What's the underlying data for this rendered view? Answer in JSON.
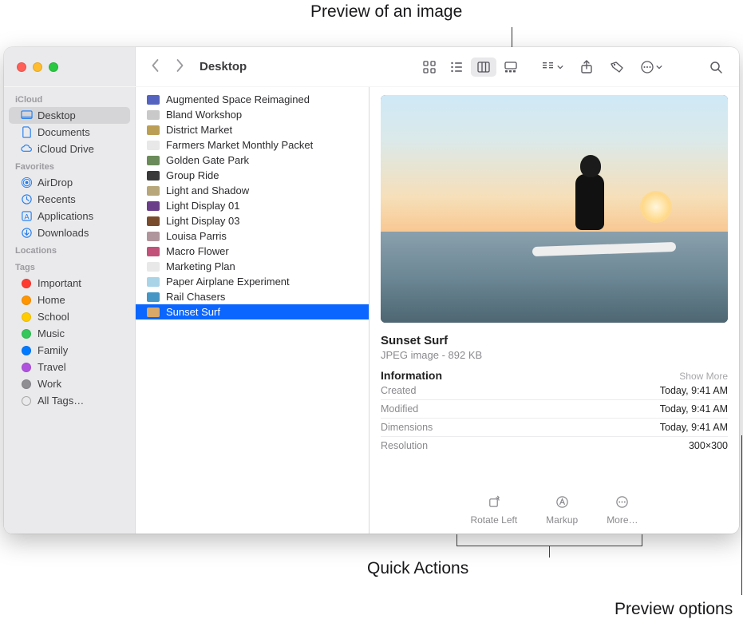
{
  "callouts": {
    "preview_image": "Preview of an image",
    "quick_actions": "Quick Actions",
    "preview_options": "Preview options"
  },
  "window": {
    "title": "Desktop"
  },
  "sidebar": {
    "sections": {
      "icloud": "iCloud",
      "favorites": "Favorites",
      "locations": "Locations",
      "tags": "Tags"
    },
    "icloud_items": [
      {
        "label": "Desktop",
        "icon": "desktop"
      },
      {
        "label": "Documents",
        "icon": "doc"
      },
      {
        "label": "iCloud Drive",
        "icon": "cloud"
      }
    ],
    "favorites_items": [
      {
        "label": "AirDrop",
        "icon": "airdrop"
      },
      {
        "label": "Recents",
        "icon": "clock"
      },
      {
        "label": "Applications",
        "icon": "apps"
      },
      {
        "label": "Downloads",
        "icon": "download"
      }
    ],
    "tags_items": [
      {
        "label": "Important",
        "color": "#ff3b30"
      },
      {
        "label": "Home",
        "color": "#ff9500"
      },
      {
        "label": "School",
        "color": "#ffcc00"
      },
      {
        "label": "Music",
        "color": "#34c759"
      },
      {
        "label": "Family",
        "color": "#007aff"
      },
      {
        "label": "Travel",
        "color": "#af52de"
      },
      {
        "label": "Work",
        "color": "#8e8e93"
      },
      {
        "label": "All Tags…",
        "color": "gray-outline"
      }
    ]
  },
  "files": [
    {
      "name": "Augmented Space Reimagined",
      "color": "#5463bf"
    },
    {
      "name": "Bland Workshop",
      "color": "#c9c9c9"
    },
    {
      "name": "District Market",
      "color": "#bb9f55"
    },
    {
      "name": "Farmers Market Monthly Packet",
      "color": "#e8e8e8"
    },
    {
      "name": "Golden Gate Park",
      "color": "#6b8c5a"
    },
    {
      "name": "Group Ride",
      "color": "#3a3a3a"
    },
    {
      "name": "Light and Shadow",
      "color": "#b8a77a"
    },
    {
      "name": "Light Display 01",
      "color": "#6b3e8a"
    },
    {
      "name": "Light Display 03",
      "color": "#7a4c2e"
    },
    {
      "name": "Louisa Parris",
      "color": "#b0959c"
    },
    {
      "name": "Macro Flower",
      "color": "#c2527a"
    },
    {
      "name": "Marketing Plan",
      "color": "#e8e8e8"
    },
    {
      "name": "Paper Airplane Experiment",
      "color": "#a9d4e8"
    },
    {
      "name": "Rail Chasers",
      "color": "#4596c4"
    },
    {
      "name": "Sunset Surf",
      "color": "#d9a96a"
    }
  ],
  "preview": {
    "name": "Sunset Surf",
    "subtitle": "JPEG image - 892 KB",
    "info_label": "Information",
    "show_more": "Show More",
    "rows": [
      {
        "k": "Created",
        "v": "Today, 9:41 AM"
      },
      {
        "k": "Modified",
        "v": "Today, 9:41 AM"
      },
      {
        "k": "Dimensions",
        "v": "Today, 9:41 AM"
      },
      {
        "k": "Resolution",
        "v": "300×300"
      }
    ]
  },
  "quick_actions": {
    "rotate": "Rotate Left",
    "markup": "Markup",
    "more": "More…"
  }
}
